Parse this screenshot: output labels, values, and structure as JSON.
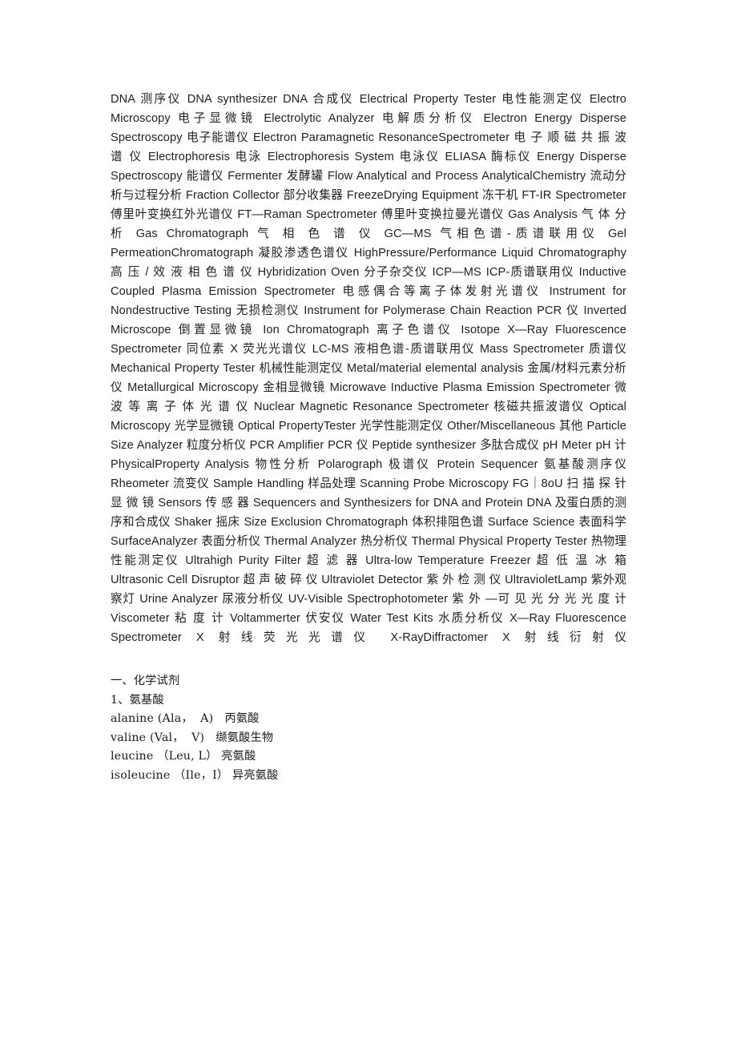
{
  "document": {
    "background_color": "#ffffff",
    "text_color": "#1f1f1f",
    "glossary": {
      "body": "DNA 测序仪              DNA synthesizer DNA 合成仪              Electrical Property Tester 电性能测定仪              Electro Microscopy 电子显微镜              Electrolytic Analyzer 电解质分析仪              Electron Energy Disperse Spectroscopy 电子能谱仪 Electron Paramagnetic ResonanceSpectrometer 电 子 顺 磁 共 振 波 谱 仪 Electrophoresis 电泳              Electrophoresis System 电泳仪              ELIASA 酶标仪              Energy Disperse Spectroscopy 能谱仪              Fermenter 发酵罐 Flow Analytical and Process AnalyticalChemistry 流动分析与过程分析     Fraction Collector 部分收集器              FreezeDrying Equipment 冻干机              FT-IR Spectrometer 傅里叶变换红外光谱仪     FT—Raman Spectrometer 傅里叶变换拉曼光谱仪     Gas Analysis 气 体 分 析              Gas Chromatograph 气 相 色 谱 仪 GC—MS 气相色谱-质谱联用仪     Gel PermeationChromatograph 凝胶渗透色谱仪 HighPressure/Performance Liquid Chromatography 高 压 / 效 液 相 色 谱 仪 Hybridization Oven 分子杂交仪              ICP—MS ICP-质谱联用仪              Inductive Coupled Plasma Emission Spectrometer 电感偶合等离子体发射光谱仪     Instrument for Nondestructive Testing 无损检测仪              Instrument for Polymerase Chain Reaction PCR 仪              Inverted Microscope 倒置显微镜              Ion Chromatograph 离子色谱仪              Isotope X—Ray Fluorescence Spectrometer 同位素 X 荧光光谱仪 LC-MS 液相色谱-质谱联用仪     Mass Spectrometer 质谱仪              Mechanical Property Tester 机械性能测定仪              Metal/material elemental analysis 金属/材料元素分析仪     Metallurgical Microscopy 金相显微镜              Microwave Inductive Plasma Emission Spectrometer 微 波 等 离 子 体 光 谱 仪              Nuclear Magnetic Resonance Spectrometer 核磁共振波谱仪              Optical Microscopy 光学显微镜              Optical PropertyTester 光学性能测定仪              Other/Miscellaneous 其他              Particle Size Analyzer 粒度分析仪              PCR Amplifier PCR 仪              Peptide synthesizer 多肽合成仪              pH Meter pH 计              PhysicalProperty Analysis 物性分析              Polarograph 极谱仪              Protein Sequencer 氨基酸测序仪              Rheometer 流变仪              Sample Handling 样品处理 Scanning Probe Microscopy   FG｜8oU 扫 描 探 针 显 微 镜              Sensors 传 感 器 Sequencers and Synthesizers for DNA and Protein DNA 及蛋白质的测序和合成仪 Shaker 摇床              Size Exclusion Chromatograph 体积排阻色谱              Surface Science 表面科学              SurfaceAnalyzer 表面分析仪              Thermal Analyzer 热分析仪              Thermal Physical Property Tester 热物理性能测定仪              Ultrahigh Purity Filter 超 滤 器              Ultra-low Temperature Freezer 超 低 温 冰 箱 Ultrasonic Cell Disruptor 超 声 破 碎 仪              Ultraviolet Detector 紫 外 检 测 仪 UltravioletLamp 紫外观察灯              Urine Analyzer 尿液分析仪              UV-Visible Spectrophotometer 紫 外 —可 见 光 分 光 光 度 计              Viscometer 粘 度 计 Voltammerter 伏安仪              Water Test Kits 水质分析仪              X—Ray Fluorescence Spectrometer X 射线荧光光谱仪              X-RayDiffractomer X 射线衍射仪",
      "entries": [
        {
          "en": "DNA",
          "zh": "测序仪"
        },
        {
          "en": "DNA synthesizer DNA",
          "zh": "合成仪"
        },
        {
          "en": "Electrical Property Tester",
          "zh": "电性能测定仪"
        },
        {
          "en": "Electro Microscopy",
          "zh": "电子显微镜"
        },
        {
          "en": "Electrolytic Analyzer",
          "zh": "电解质分析仪"
        },
        {
          "en": "Electron Energy Disperse Spectroscopy",
          "zh": "电子能谱仪"
        },
        {
          "en": "Electron Paramagnetic ResonanceSpectrometer",
          "zh": "电子顺磁共振波谱仪"
        },
        {
          "en": "Electrophoresis",
          "zh": "电泳"
        },
        {
          "en": "Electrophoresis System",
          "zh": "电泳仪"
        },
        {
          "en": "ELIASA",
          "zh": "酶标仪"
        },
        {
          "en": "Energy Disperse Spectroscopy",
          "zh": "能谱仪"
        },
        {
          "en": "Fermenter",
          "zh": "发酵罐"
        },
        {
          "en": "Flow Analytical and Process AnalyticalChemistry",
          "zh": "流动分析与过程分析"
        },
        {
          "en": "Fraction Collector",
          "zh": "部分收集器"
        },
        {
          "en": "FreezeDrying Equipment",
          "zh": "冻干机"
        },
        {
          "en": "FT-IR Spectrometer",
          "zh": "傅里叶变换红外光谱仪"
        },
        {
          "en": "FT—Raman Spectrometer",
          "zh": "傅里叶变换拉曼光谱仪"
        },
        {
          "en": "Gas Analysis",
          "zh": "气体分析"
        },
        {
          "en": "Gas Chromatograph",
          "zh": "气相色谱仪"
        },
        {
          "en": "GC—MS",
          "zh": "气相色谱-质谱联用仪"
        },
        {
          "en": "Gel PermeationChromatograph",
          "zh": "凝胶渗透色谱仪"
        },
        {
          "en": "HighPressure/Performance Liquid Chromatography",
          "zh": "高压/效液相色谱仪"
        },
        {
          "en": "Hybridization Oven",
          "zh": "分子杂交仪"
        },
        {
          "en": "ICP—MS ICP-",
          "zh": "质谱联用仪"
        },
        {
          "en": "Inductive Coupled Plasma Emission Spectrometer",
          "zh": "电感偶合等离子体发射光谱仪"
        },
        {
          "en": "Instrument for Nondestructive Testing",
          "zh": "无损检测仪"
        },
        {
          "en": "Instrument for Polymerase Chain Reaction PCR",
          "zh": "仪"
        },
        {
          "en": "Inverted Microscope",
          "zh": "倒置显微镜"
        },
        {
          "en": "Ion Chromatograph",
          "zh": "离子色谱仪"
        },
        {
          "en": "Isotope X—Ray Fluorescence Spectrometer",
          "zh": "同位素 X 荧光光谱仪"
        },
        {
          "en": "LC-MS",
          "zh": "液相色谱-质谱联用仪"
        },
        {
          "en": "Mass Spectrometer",
          "zh": "质谱仪"
        },
        {
          "en": "Mechanical Property Tester",
          "zh": "机械性能测定仪"
        },
        {
          "en": "Metal/material elemental analysis",
          "zh": "金属/材料元素分析仪"
        },
        {
          "en": "Metallurgical Microscopy",
          "zh": "金相显微镜"
        },
        {
          "en": "Microwave Inductive Plasma Emission Spectrometer",
          "zh": "微波等离子体光谱仪"
        },
        {
          "en": "Nuclear Magnetic Resonance Spectrometer",
          "zh": "核磁共振波谱仪"
        },
        {
          "en": "Optical Microscopy",
          "zh": "光学显微镜"
        },
        {
          "en": "Optical PropertyTester",
          "zh": "光学性能测定仪"
        },
        {
          "en": "Other/Miscellaneous",
          "zh": "其他"
        },
        {
          "en": "Particle Size Analyzer",
          "zh": "粒度分析仪"
        },
        {
          "en": "PCR Amplifier PCR",
          "zh": "仪"
        },
        {
          "en": "Peptide synthesizer",
          "zh": "多肽合成仪"
        },
        {
          "en": "pH Meter pH",
          "zh": "计"
        },
        {
          "en": "PhysicalProperty Analysis",
          "zh": "物性分析"
        },
        {
          "en": "Polarograph",
          "zh": "极谱仪"
        },
        {
          "en": "Protein Sequencer",
          "zh": "氨基酸测序仪"
        },
        {
          "en": "Rheometer",
          "zh": "流变仪"
        },
        {
          "en": "Sample Handling",
          "zh": "样品处理"
        },
        {
          "en": "Scanning Probe Microscopy FG｜8oU",
          "zh": "扫描探针显微镜"
        },
        {
          "en": "Sensors",
          "zh": "传感器"
        },
        {
          "en": "Sequencers and Synthesizers for DNA and Protein DNA",
          "zh": "及蛋白质的测序和合成仪"
        },
        {
          "en": "Shaker",
          "zh": "摇床"
        },
        {
          "en": "Size Exclusion Chromatograph",
          "zh": "体积排阻色谱"
        },
        {
          "en": "Surface Science",
          "zh": "表面科学"
        },
        {
          "en": "SurfaceAnalyzer",
          "zh": "表面分析仪"
        },
        {
          "en": "Thermal Analyzer",
          "zh": "热分析仪"
        },
        {
          "en": "Thermal Physical Property Tester",
          "zh": "热物理性能测定仪"
        },
        {
          "en": "Ultrahigh Purity Filter",
          "zh": "超滤器"
        },
        {
          "en": "Ultra-low Temperature Freezer",
          "zh": "超低温冰箱"
        },
        {
          "en": "Ultrasonic Cell Disruptor",
          "zh": "超声破碎仪"
        },
        {
          "en": "Ultraviolet Detector",
          "zh": "紫外检测仪"
        },
        {
          "en": "UltravioletLamp",
          "zh": "紫外观察灯"
        },
        {
          "en": "Urine Analyzer",
          "zh": "尿液分析仪"
        },
        {
          "en": "UV-Visible Spectrophotometer",
          "zh": "紫外—可见光分光光度计"
        },
        {
          "en": "Viscometer",
          "zh": "粘度计"
        },
        {
          "en": "Voltammerter",
          "zh": "伏安仪"
        },
        {
          "en": "Water Test Kits",
          "zh": "水质分析仪"
        },
        {
          "en": "X—Ray Fluorescence Spectrometer X",
          "zh": "射线荧光光谱仪"
        },
        {
          "en": "X-RayDiffractomer X",
          "zh": "射线衍射仪"
        }
      ]
    },
    "reagents": {
      "section_heading": "一、化学试剂",
      "subsection_heading": "1、氨基酸",
      "lines": [
        "alanine (Ala，  A)   丙氨酸",
        "valine (Val，  V)   缬氨酸生物",
        "leucine （Leu, L） 亮氨酸",
        "isoleucine （Ile，I） 异亮氨酸"
      ]
    }
  }
}
